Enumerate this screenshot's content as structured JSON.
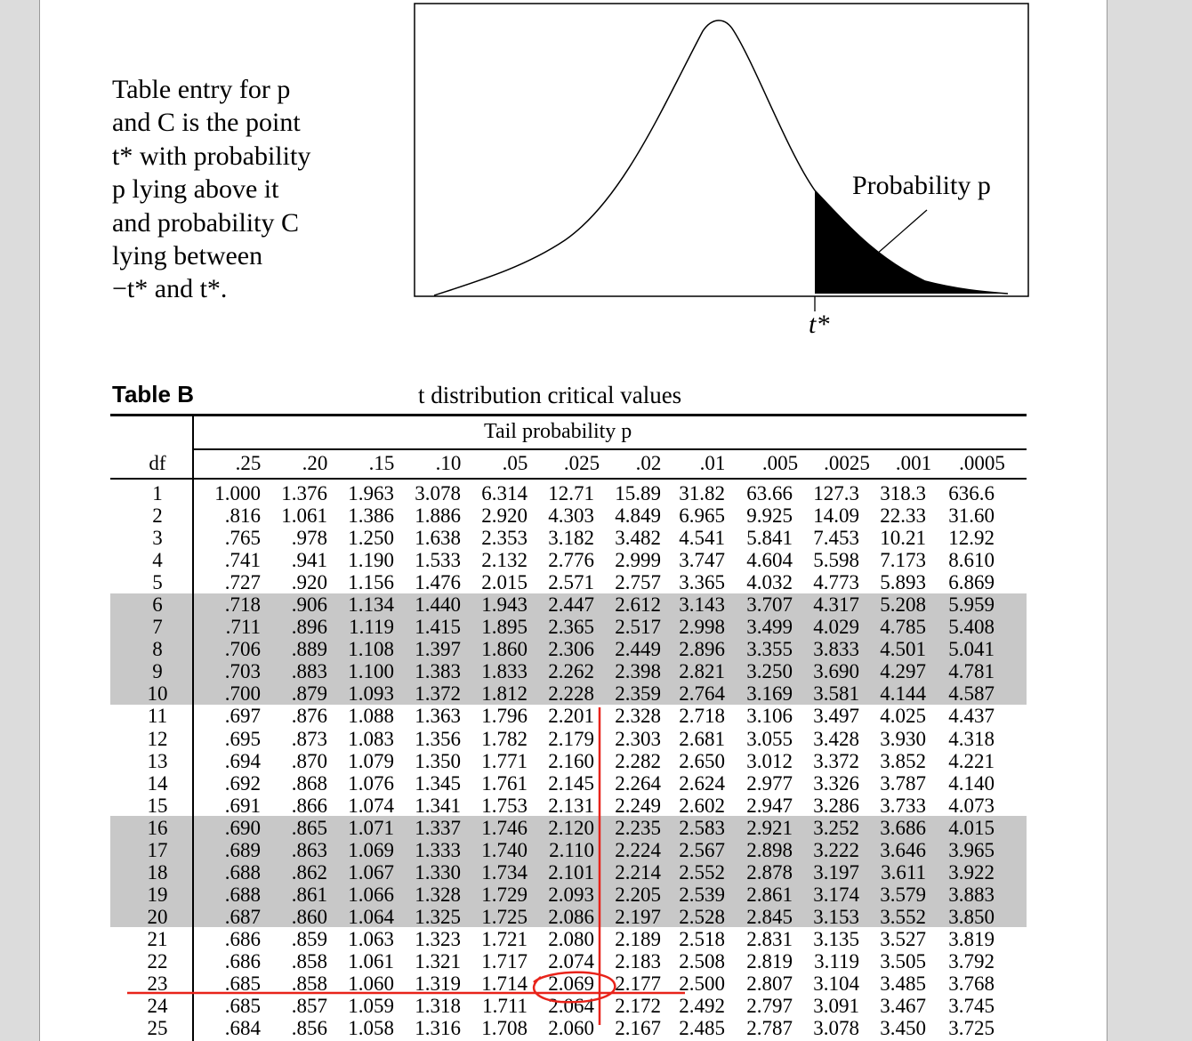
{
  "intro": "Table entry for p\nand C is the point\nt* with probability\np lying above it\nand probability C\nlying between\n−t* and t*.",
  "figure": {
    "prob_label": "Probability p",
    "tstar_label": "t*"
  },
  "table": {
    "label": "Table B",
    "title": "t distribution critical values",
    "tail_prob_label": "Tail probability p",
    "df_header": "df",
    "columns": [
      ".25",
      ".20",
      ".15",
      ".10",
      ".05",
      ".025",
      ".02",
      ".01",
      ".005",
      ".0025",
      ".001",
      ".0005"
    ],
    "df": [
      "1",
      "2",
      "3",
      "4",
      "5",
      "6",
      "7",
      "8",
      "9",
      "10",
      "11",
      "12",
      "13",
      "14",
      "15",
      "16",
      "17",
      "18",
      "19",
      "20",
      "21",
      "22",
      "23",
      "24",
      "25"
    ],
    "cols": [
      [
        "1.000",
        ".816",
        ".765",
        ".741",
        ".727",
        ".718",
        ".711",
        ".706",
        ".703",
        ".700",
        ".697",
        ".695",
        ".694",
        ".692",
        ".691",
        ".690",
        ".689",
        ".688",
        ".688",
        ".687",
        ".686",
        ".686",
        ".685",
        ".685",
        ".684"
      ],
      [
        "1.376",
        "1.061",
        ".978",
        ".941",
        ".920",
        ".906",
        ".896",
        ".889",
        ".883",
        ".879",
        ".876",
        ".873",
        ".870",
        ".868",
        ".866",
        ".865",
        ".863",
        ".862",
        ".861",
        ".860",
        ".859",
        ".858",
        ".858",
        ".857",
        ".856"
      ],
      [
        "1.963",
        "1.386",
        "1.250",
        "1.190",
        "1.156",
        "1.134",
        "1.119",
        "1.108",
        "1.100",
        "1.093",
        "1.088",
        "1.083",
        "1.079",
        "1.076",
        "1.074",
        "1.071",
        "1.069",
        "1.067",
        "1.066",
        "1.064",
        "1.063",
        "1.061",
        "1.060",
        "1.059",
        "1.058"
      ],
      [
        "3.078",
        "1.886",
        "1.638",
        "1.533",
        "1.476",
        "1.440",
        "1.415",
        "1.397",
        "1.383",
        "1.372",
        "1.363",
        "1.356",
        "1.350",
        "1.345",
        "1.341",
        "1.337",
        "1.333",
        "1.330",
        "1.328",
        "1.325",
        "1.323",
        "1.321",
        "1.319",
        "1.318",
        "1.316"
      ],
      [
        "6.314",
        "2.920",
        "2.353",
        "2.132",
        "2.015",
        "1.943",
        "1.895",
        "1.860",
        "1.833",
        "1.812",
        "1.796",
        "1.782",
        "1.771",
        "1.761",
        "1.753",
        "1.746",
        "1.740",
        "1.734",
        "1.729",
        "1.725",
        "1.721",
        "1.717",
        "1.714",
        "1.711",
        "1.708"
      ],
      [
        "12.71",
        "4.303",
        "3.182",
        "2.776",
        "2.571",
        "2.447",
        "2.365",
        "2.306",
        "2.262",
        "2.228",
        "2.201",
        "2.179",
        "2.160",
        "2.145",
        "2.131",
        "2.120",
        "2.110",
        "2.101",
        "2.093",
        "2.086",
        "2.080",
        "2.074",
        "2.069",
        "2.064",
        "2.060"
      ],
      [
        "15.89",
        "4.849",
        "3.482",
        "2.999",
        "2.757",
        "2.612",
        "2.517",
        "2.449",
        "2.398",
        "2.359",
        "2.328",
        "2.303",
        "2.282",
        "2.264",
        "2.249",
        "2.235",
        "2.224",
        "2.214",
        "2.205",
        "2.197",
        "2.189",
        "2.183",
        "2.177",
        "2.172",
        "2.167"
      ],
      [
        "31.82",
        "6.965",
        "4.541",
        "3.747",
        "3.365",
        "3.143",
        "2.998",
        "2.896",
        "2.821",
        "2.764",
        "2.718",
        "2.681",
        "2.650",
        "2.624",
        "2.602",
        "2.583",
        "2.567",
        "2.552",
        "2.539",
        "2.528",
        "2.518",
        "2.508",
        "2.500",
        "2.492",
        "2.485"
      ],
      [
        "63.66",
        "9.925",
        "5.841",
        "4.604",
        "4.032",
        "3.707",
        "3.499",
        "3.355",
        "3.250",
        "3.169",
        "3.106",
        "3.055",
        "3.012",
        "2.977",
        "2.947",
        "2.921",
        "2.898",
        "2.878",
        "2.861",
        "2.845",
        "2.831",
        "2.819",
        "2.807",
        "2.797",
        "2.787"
      ],
      [
        "127.3",
        "14.09",
        "7.453",
        "5.598",
        "4.773",
        "4.317",
        "4.029",
        "3.833",
        "3.690",
        "3.581",
        "3.497",
        "3.428",
        "3.372",
        "3.326",
        "3.286",
        "3.252",
        "3.222",
        "3.197",
        "3.174",
        "3.153",
        "3.135",
        "3.119",
        "3.104",
        "3.091",
        "3.078"
      ],
      [
        "318.3",
        "22.33",
        "10.21",
        "7.173",
        "5.893",
        "5.208",
        "4.785",
        "4.501",
        "4.297",
        "4.144",
        "4.025",
        "3.930",
        "3.852",
        "3.787",
        "3.733",
        "3.686",
        "3.646",
        "3.611",
        "3.579",
        "3.552",
        "3.527",
        "3.505",
        "3.485",
        "3.467",
        "3.450"
      ],
      [
        "636.6",
        "31.60",
        "12.92",
        "8.610",
        "6.869",
        "5.959",
        "5.408",
        "5.041",
        "4.781",
        "4.587",
        "4.437",
        "4.318",
        "4.221",
        "4.140",
        "4.073",
        "4.015",
        "3.965",
        "3.922",
        "3.883",
        "3.850",
        "3.819",
        "3.792",
        "3.768",
        "3.745",
        "3.725"
      ]
    ]
  },
  "colors": {
    "annotation": "#e8231a",
    "band": "#c8c8c8"
  }
}
